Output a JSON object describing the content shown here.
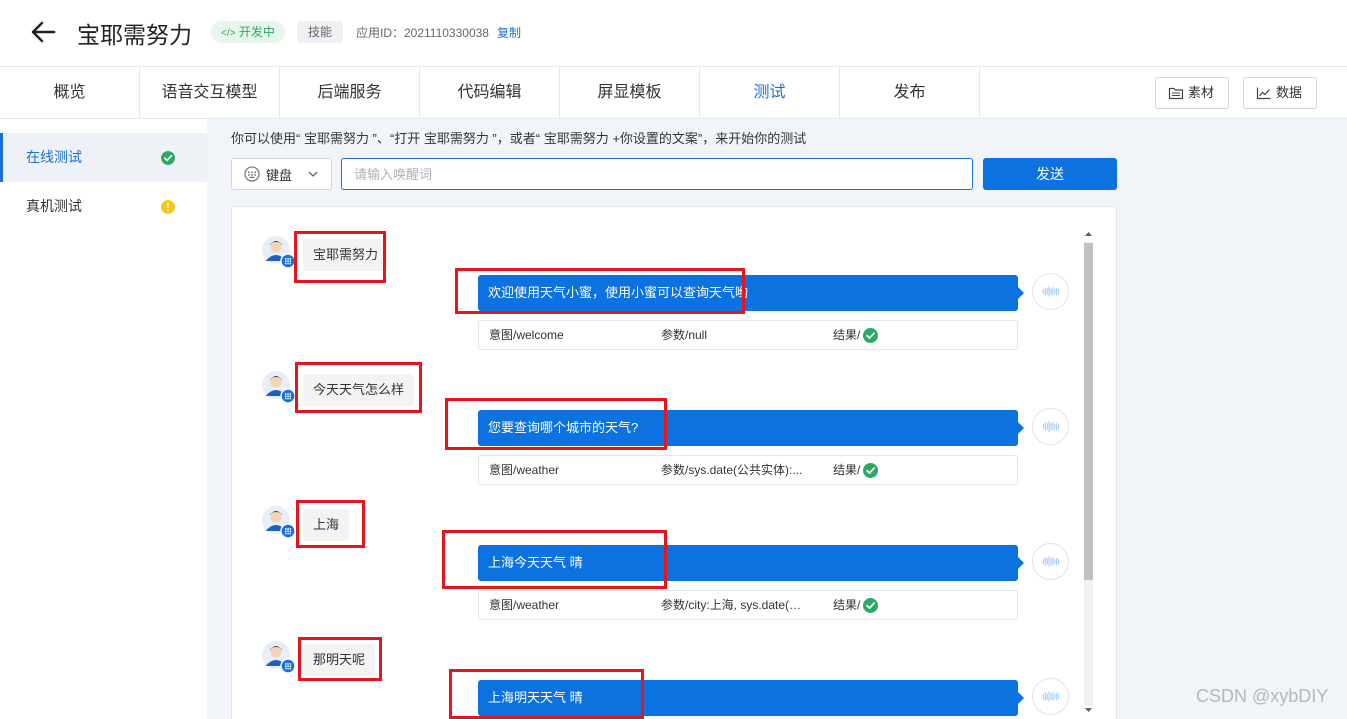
{
  "header": {
    "title": "宝耶需努力",
    "status_badge": "开发中",
    "type_badge": "技能",
    "app_id": "应用ID：2021110330038",
    "copy_label": "复制"
  },
  "tabs": [
    {
      "label": "概览"
    },
    {
      "label": "语音交互模型"
    },
    {
      "label": "后端服务"
    },
    {
      "label": "代码编辑"
    },
    {
      "label": "屏显模板"
    },
    {
      "label": "测试"
    },
    {
      "label": "发布"
    }
  ],
  "active_tab": "测试",
  "toolbar": {
    "materials_label": "素材",
    "data_label": "数据"
  },
  "sidebar": {
    "items": [
      {
        "label": "在线测试",
        "status": "success"
      },
      {
        "label": "真机测试",
        "status": "warning"
      }
    ]
  },
  "hint": "你可以使用“ 宝耶需努力 ”、“打开 宝耶需努力 ”，或者“ 宝耶需努力 +你设置的文案”，来开始你的测试",
  "input_mode": {
    "label": "键盘"
  },
  "wake_input": {
    "placeholder": "请输入唤醒词",
    "value": ""
  },
  "send_label": "发送",
  "conversation": [
    {
      "user": "宝耶需努力",
      "bot": "欢迎使用天气小蜜，使用小蜜可以查询天气哟",
      "intent": "意图/welcome",
      "params": "参数/null",
      "result": "结果/"
    },
    {
      "user": "今天天气怎么样",
      "bot": "您要查询哪个城市的天气?",
      "intent": "意图/weather",
      "params": "参数/sys.date(公共实体):...",
      "result": "结果/"
    },
    {
      "user": "上海",
      "bot": "上海今天天气 晴",
      "intent": "意图/weather",
      "params": "参数/city:上海, sys.date(公...",
      "result": "结果/"
    },
    {
      "user": "那明天呢",
      "bot": "上海明天天气 晴",
      "intent": "",
      "params": "",
      "result": ""
    }
  ],
  "colors": {
    "primary": "#0b72e0",
    "success": "#2ea865",
    "warning": "#f5c518",
    "highlight": "#e8141b"
  },
  "watermark": "CSDN @xybDIY"
}
